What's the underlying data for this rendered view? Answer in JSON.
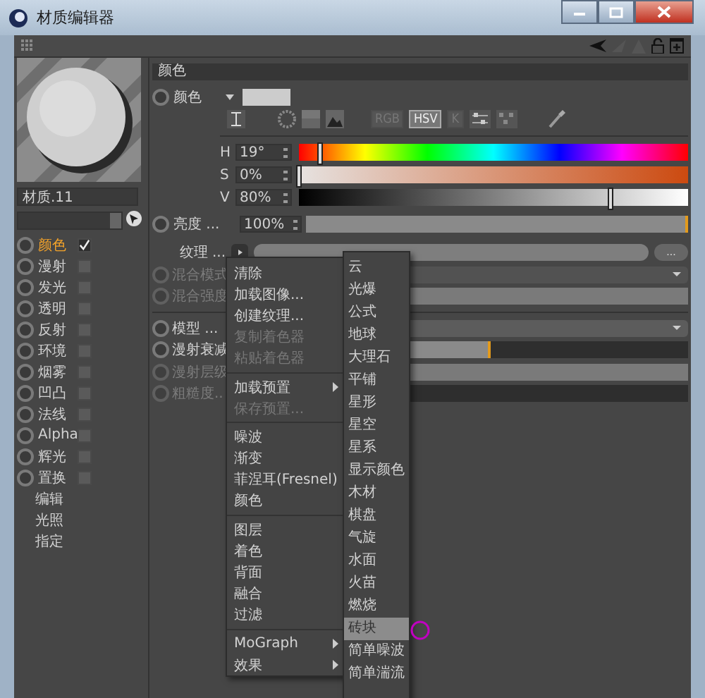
{
  "window": {
    "title": "材质编辑器"
  },
  "material": {
    "name": "材质.11"
  },
  "channels": [
    {
      "label": "颜色",
      "selected": true,
      "checked": true
    },
    {
      "label": "漫射",
      "selected": false,
      "checked": false
    },
    {
      "label": "发光",
      "selected": false,
      "checked": false
    },
    {
      "label": "透明",
      "selected": false,
      "checked": false
    },
    {
      "label": "反射",
      "selected": false,
      "checked": false
    },
    {
      "label": "环境",
      "selected": false,
      "checked": false
    },
    {
      "label": "烟雾",
      "selected": false,
      "checked": false
    },
    {
      "label": "凹凸",
      "selected": false,
      "checked": false
    },
    {
      "label": "法线",
      "selected": false,
      "checked": false
    },
    {
      "label": "Alpha",
      "selected": false,
      "checked": false
    },
    {
      "label": "辉光",
      "selected": false,
      "checked": false
    },
    {
      "label": "置换",
      "selected": false,
      "checked": false
    }
  ],
  "extra_items": [
    "编辑",
    "光照",
    "指定"
  ],
  "section": {
    "title": "颜色"
  },
  "color": {
    "label": "颜色",
    "modes": [
      {
        "label": "RGB",
        "selected": false
      },
      {
        "label": "HSV",
        "selected": true
      },
      {
        "label": "K",
        "selected": false
      }
    ],
    "channels": [
      {
        "label": "H",
        "value": "19°",
        "level": 0.053,
        "kind": "hue"
      },
      {
        "label": "S",
        "value": "0%",
        "level": 0,
        "kind": "saturation"
      },
      {
        "label": "V",
        "value": "80%",
        "level": 0.8,
        "kind": "value"
      }
    ]
  },
  "brightness": {
    "label": "亮度 ...",
    "value": "100%",
    "level": 1
  },
  "texture": {
    "label": "纹理 ...",
    "button": "..."
  },
  "params": [
    {
      "label": "混合模式",
      "kind": "dropdown",
      "disabled": true
    },
    {
      "label": "混合强度",
      "kind": "slider",
      "disabled": true,
      "level": 1
    },
    {
      "label": "模型 ...",
      "kind": "dropdown",
      "disabled": false
    },
    {
      "label": "漫射衰减",
      "kind": "slider",
      "disabled": false,
      "level": 0.5
    },
    {
      "label": "漫射层级",
      "kind": "slider",
      "disabled": true,
      "level": 1
    },
    {
      "label": "粗糙度..",
      "kind": "slider",
      "disabled": true
    }
  ],
  "context_menu": [
    {
      "kind": "item",
      "label": "清除",
      "disabled": false,
      "submenu": false
    },
    {
      "kind": "item",
      "label": "加载图像...",
      "disabled": false,
      "submenu": false
    },
    {
      "kind": "item",
      "label": "创建纹理...",
      "disabled": false,
      "submenu": false
    },
    {
      "kind": "item",
      "label": "复制着色器",
      "disabled": true,
      "submenu": false
    },
    {
      "kind": "item",
      "label": "粘贴着色器",
      "disabled": true,
      "submenu": false
    },
    {
      "kind": "separator"
    },
    {
      "kind": "item",
      "label": "加载预置",
      "disabled": false,
      "submenu": true
    },
    {
      "kind": "item",
      "label": "保存预置...",
      "disabled": true,
      "submenu": false
    },
    {
      "kind": "separator"
    },
    {
      "kind": "item",
      "label": "噪波",
      "disabled": false,
      "submenu": false
    },
    {
      "kind": "item",
      "label": "渐变",
      "disabled": false,
      "submenu": false
    },
    {
      "kind": "item",
      "label": "菲涅耳(Fresnel)",
      "disabled": false,
      "submenu": false
    },
    {
      "kind": "item",
      "label": "颜色",
      "disabled": false,
      "submenu": false
    },
    {
      "kind": "separator"
    },
    {
      "kind": "item",
      "label": "图层",
      "disabled": false,
      "submenu": false
    },
    {
      "kind": "item",
      "label": "着色",
      "disabled": false,
      "submenu": false
    },
    {
      "kind": "item",
      "label": "背面",
      "disabled": false,
      "submenu": false
    },
    {
      "kind": "item",
      "label": "融合",
      "disabled": false,
      "submenu": false
    },
    {
      "kind": "item",
      "label": "过滤",
      "disabled": false,
      "submenu": false
    },
    {
      "kind": "separator"
    },
    {
      "kind": "item",
      "label": "MoGraph",
      "disabled": false,
      "submenu": true
    },
    {
      "kind": "item",
      "label": "效果",
      "disabled": false,
      "submenu": true
    }
  ],
  "submenu": [
    {
      "label": "云",
      "selected": false
    },
    {
      "label": "光爆",
      "selected": false
    },
    {
      "label": "公式",
      "selected": false
    },
    {
      "label": "地球",
      "selected": false
    },
    {
      "label": "大理石",
      "selected": false
    },
    {
      "label": "平铺",
      "selected": false
    },
    {
      "label": "星形",
      "selected": false
    },
    {
      "label": "星空",
      "selected": false
    },
    {
      "label": "星系",
      "selected": false
    },
    {
      "label": "显示颜色",
      "selected": false
    },
    {
      "label": "木材",
      "selected": false
    },
    {
      "label": "棋盘",
      "selected": false
    },
    {
      "label": "气旋",
      "selected": false
    },
    {
      "label": "水面",
      "selected": false
    },
    {
      "label": "火苗",
      "selected": false
    },
    {
      "label": "燃烧",
      "selected": false
    },
    {
      "label": "砖块",
      "selected": true
    },
    {
      "label": "简单噪波",
      "selected": false
    },
    {
      "label": "简单湍流",
      "selected": false
    }
  ]
}
